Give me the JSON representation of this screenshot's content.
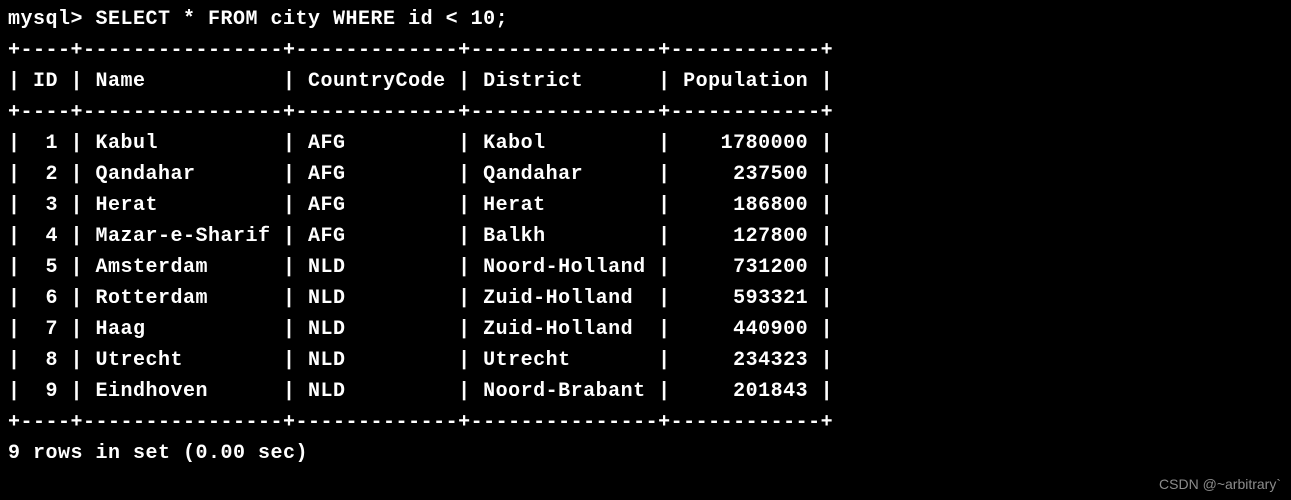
{
  "prompt": "mysql>",
  "query": "SELECT * FROM city WHERE id < 10;",
  "widths": {
    "ID": 4,
    "Name": 16,
    "CountryCode": 13,
    "District": 15,
    "Population": 12
  },
  "headers": [
    "ID",
    "Name",
    "CountryCode",
    "District",
    "Population"
  ],
  "rows": [
    {
      "ID": 1,
      "Name": "Kabul",
      "CountryCode": "AFG",
      "District": "Kabol",
      "Population": 1780000
    },
    {
      "ID": 2,
      "Name": "Qandahar",
      "CountryCode": "AFG",
      "District": "Qandahar",
      "Population": 237500
    },
    {
      "ID": 3,
      "Name": "Herat",
      "CountryCode": "AFG",
      "District": "Herat",
      "Population": 186800
    },
    {
      "ID": 4,
      "Name": "Mazar-e-Sharif",
      "CountryCode": "AFG",
      "District": "Balkh",
      "Population": 127800
    },
    {
      "ID": 5,
      "Name": "Amsterdam",
      "CountryCode": "NLD",
      "District": "Noord-Holland",
      "Population": 731200
    },
    {
      "ID": 6,
      "Name": "Rotterdam",
      "CountryCode": "NLD",
      "District": "Zuid-Holland",
      "Population": 593321
    },
    {
      "ID": 7,
      "Name": "Haag",
      "CountryCode": "NLD",
      "District": "Zuid-Holland",
      "Population": 440900
    },
    {
      "ID": 8,
      "Name": "Utrecht",
      "CountryCode": "NLD",
      "District": "Utrecht",
      "Population": 234323
    },
    {
      "ID": 9,
      "Name": "Eindhoven",
      "CountryCode": "NLD",
      "District": "Noord-Brabant",
      "Population": 201843
    }
  ],
  "footer": "9 rows in set (0.00 sec)",
  "watermark": "CSDN @~arbitrary`"
}
